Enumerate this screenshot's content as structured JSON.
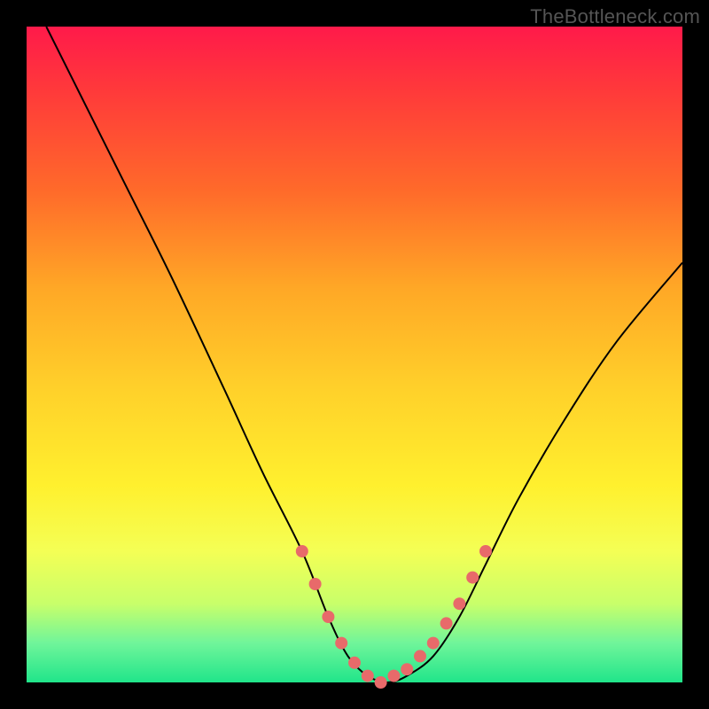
{
  "watermark": "TheBottleneck.com",
  "chart_data": {
    "type": "line",
    "title": "",
    "xlabel": "",
    "ylabel": "",
    "xlim": [
      0,
      100
    ],
    "ylim": [
      0,
      100
    ],
    "series": [
      {
        "name": "bottleneck-curve",
        "x": [
          3,
          8,
          15,
          22,
          30,
          36,
          42,
          46,
          49,
          52,
          55,
          58,
          62,
          66,
          70,
          75,
          82,
          90,
          100
        ],
        "y": [
          100,
          90,
          76,
          62,
          45,
          32,
          20,
          10,
          4,
          1,
          0,
          1,
          4,
          10,
          18,
          28,
          40,
          52,
          64
        ]
      }
    ],
    "markers": {
      "name": "highlight-points",
      "x": [
        42,
        44,
        46,
        48,
        50,
        52,
        54,
        56,
        58,
        60,
        62,
        64,
        66,
        68,
        70
      ],
      "y": [
        20,
        15,
        10,
        6,
        3,
        1,
        0,
        1,
        2,
        4,
        6,
        9,
        12,
        16,
        20
      ]
    }
  }
}
